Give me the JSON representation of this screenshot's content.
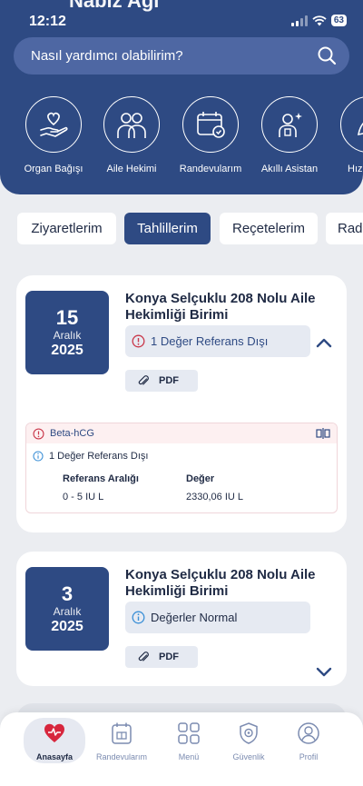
{
  "status_bar": {
    "time": "12:12",
    "battery": "63"
  },
  "header": {
    "title": "Nabız Ağı"
  },
  "search": {
    "placeholder": "Nasıl yardımcı olabilirim?"
  },
  "quick_actions": [
    {
      "label": "Organ Bağışı",
      "icon": "heart-hand-icon"
    },
    {
      "label": "Aile Hekimi",
      "icon": "family-doctor-icon"
    },
    {
      "label": "Randevularım",
      "icon": "calendar-check-icon"
    },
    {
      "label": "Akıllı Asistan",
      "icon": "smart-assistant-icon"
    },
    {
      "label": "Hızlı P",
      "icon": "leaf-icon"
    }
  ],
  "tabs": [
    {
      "label": "Ziyaretlerim",
      "active": false
    },
    {
      "label": "Tahlillerim",
      "active": true
    },
    {
      "label": "Reçetelerim",
      "active": false
    },
    {
      "label": "Rad",
      "active": false
    }
  ],
  "results": [
    {
      "day": "15",
      "month": "Aralık",
      "year": "2025",
      "facility": "Konya Selçuklu 208 Nolu Aile Hekimliği Birimi",
      "status": "1 Değer Referans Dışı",
      "status_type": "alert",
      "pdf_label": "PDF",
      "expanded": true,
      "test": {
        "name": "Beta-hCG",
        "summary": "1 Değer Referans Dışı",
        "ref_header": "Referans Aralığı",
        "value_header": "Değer",
        "ref_value": "0 - 5 IU L",
        "value": "2330,06 IU L"
      }
    },
    {
      "day": "3",
      "month": "Aralık",
      "year": "2025",
      "facility": "Konya Selçuklu 208 Nolu Aile Hekimliği Birimi",
      "status": "Değerler Normal",
      "status_type": "normal",
      "pdf_label": "PDF",
      "expanded": false
    }
  ],
  "bottom_nav": [
    {
      "label": "Anasayfa",
      "icon": "home-heart-icon",
      "active": true
    },
    {
      "label": "Randevularım",
      "icon": "calendar-icon",
      "active": false
    },
    {
      "label": "Menü",
      "icon": "grid-icon",
      "active": false
    },
    {
      "label": "Güvenlik",
      "icon": "shield-gear-icon",
      "active": false
    },
    {
      "label": "Profil",
      "icon": "profile-icon",
      "active": false
    }
  ],
  "colors": {
    "primary": "#2e4a83",
    "alert": "#c9374a",
    "info": "#3b8fd6"
  }
}
